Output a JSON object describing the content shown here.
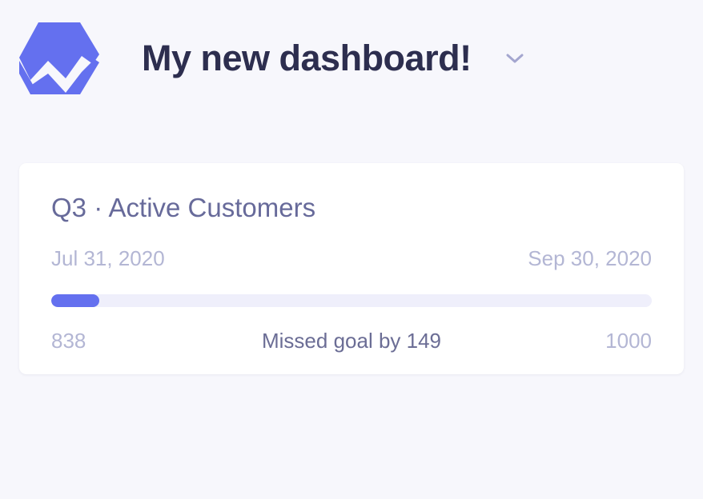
{
  "header": {
    "title": "My new dashboard!"
  },
  "icons": {
    "logo": "baremetrics-logo-icon",
    "dropdown": "chevron-down-icon"
  },
  "colors": {
    "accent": "#6470ef",
    "title": "#2d2e4f",
    "muted": "#b3b6d4",
    "card_title": "#676a9a",
    "track": "#efeffb",
    "background": "#f7f7fc"
  },
  "goal_card": {
    "title": "Q3 · Active Customers",
    "start_date": "Jul 31, 2020",
    "end_date": "Sep 30, 2020",
    "current_value": "838",
    "status": "Missed goal by 149",
    "goal_value": "1000",
    "progress_fraction": 0.08
  }
}
